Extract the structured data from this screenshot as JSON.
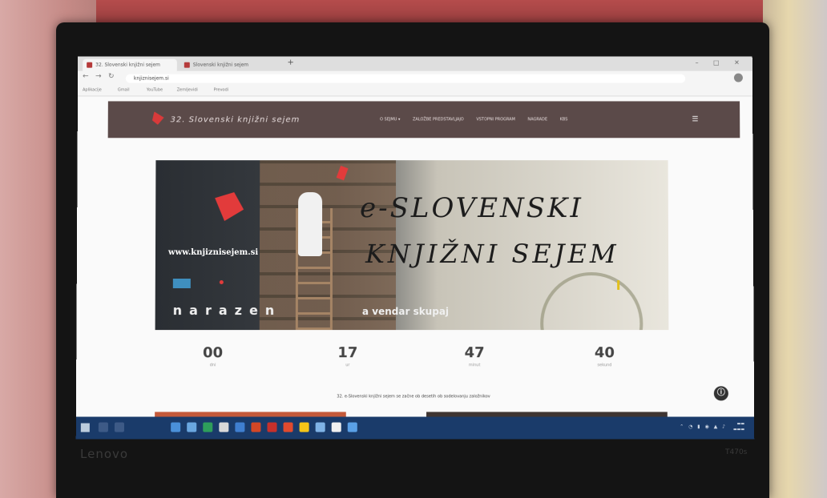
{
  "browser": {
    "tabs": [
      {
        "label": "32. Slovenski knjižni sejem"
      },
      {
        "label": "Slovenski knjižni sejem"
      }
    ],
    "url": "knjiznisejem.si",
    "bookmarks": [
      "Aplikacije",
      "Gmail",
      "YouTube",
      "Zemljevidi",
      "Prevodi"
    ]
  },
  "site": {
    "logo_text": "32. Slovenski knjižni sejem",
    "menu": [
      "O SEJMU ▾",
      "ZALOŽBE PREDSTAVLJAJO",
      "VSTOPNI PROGRAM",
      "NAGRADE",
      "KBS"
    ]
  },
  "banner": {
    "url": "www.knjiznisejem.si",
    "title_line1": "e-SLOVENSKI",
    "title_line2": "KNJIŽNI SEJEM",
    "tagline1": "narazen",
    "tagline2": "a vendar skupaj"
  },
  "countdown": [
    {
      "value": "00",
      "label": "dni"
    },
    {
      "value": "17",
      "label": "ur"
    },
    {
      "value": "47",
      "label": "minut"
    },
    {
      "value": "40",
      "label": "sekund"
    }
  ],
  "notice": "32. e-Slovenski knjižni sejem se začne ob desetih ob sodelovanju založnikov",
  "laptop": {
    "brand": "Lenovo",
    "model": "T470s"
  },
  "colors": {
    "nav_bg": "#5b4a49",
    "accent_red": "#e23b3b",
    "taskbar": "#1a3b6a"
  }
}
